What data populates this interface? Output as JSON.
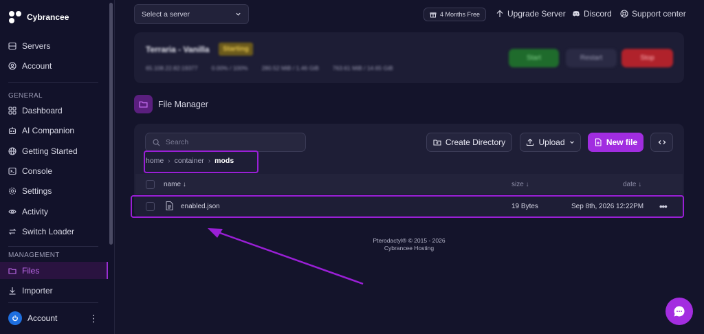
{
  "brand": {
    "name": "Cybrancee"
  },
  "sidebar": {
    "top_items": [
      {
        "label": "Servers",
        "icon": "server-icon"
      },
      {
        "label": "Account",
        "icon": "user-circle-icon"
      }
    ],
    "general_label": "GENERAL",
    "general_items": [
      {
        "label": "Dashboard",
        "icon": "grid-icon"
      },
      {
        "label": "AI Companion",
        "icon": "bot-icon"
      },
      {
        "label": "Getting Started",
        "icon": "globe-icon"
      },
      {
        "label": "Console",
        "icon": "terminal-icon"
      },
      {
        "label": "Settings",
        "icon": "gear-icon"
      },
      {
        "label": "Activity",
        "icon": "eye-icon"
      },
      {
        "label": "Switch Loader",
        "icon": "swap-icon"
      }
    ],
    "management_label": "MANAGEMENT",
    "management_items": [
      {
        "label": "Files",
        "icon": "folder-icon",
        "active": true
      },
      {
        "label": "Importer",
        "icon": "download-icon"
      }
    ],
    "account_label": "Account"
  },
  "topbar": {
    "server_select_placeholder": "Select a server",
    "promo_label": "4 Months Free",
    "upgrade_label": "Upgrade Server",
    "discord_label": "Discord",
    "support_label": "Support center"
  },
  "server": {
    "name": "Terraria - Vanilla",
    "status": "Starting",
    "stats": [
      "65.108.22.82:19377",
      "0.00% / 100%",
      "280.52 MiB / 1.46 GiB",
      "763.61 MiB / 14.65 GiB"
    ],
    "start_label": "Start",
    "restart_label": "Restart",
    "stop_label": "Stop"
  },
  "file_manager": {
    "title": "File Manager",
    "search_placeholder": "Search",
    "create_dir_label": "Create Directory",
    "upload_label": "Upload",
    "new_file_label": "New file",
    "breadcrumb": [
      "home",
      "container",
      "mods"
    ],
    "columns": {
      "name": "name ↓",
      "size": "size ↓",
      "date": "date ↓"
    },
    "files": [
      {
        "name": "enabled.json",
        "size": "19 Bytes",
        "date": "Sep 8th, 2026 12:22PM"
      }
    ]
  },
  "footer": {
    "line1": "Pterodactyl® © 2015 - 2026",
    "line2": "Cybrancee Hosting"
  },
  "colors": {
    "accent": "#a12de0",
    "highlight": "#9a1fd6",
    "background": "#14142b",
    "card": "#1e1e36"
  }
}
